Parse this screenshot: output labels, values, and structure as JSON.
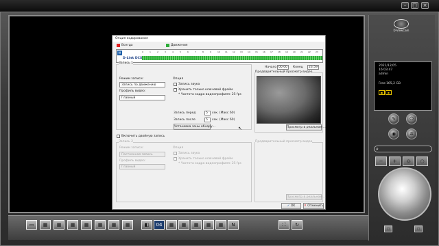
{
  "app": {
    "title": ""
  },
  "dialog": {
    "title": "Опция кодирования",
    "legend_always": "Всегда",
    "legend_motion": "Движения",
    "camera_name": "D-Link DCS",
    "ticks": [
      "0",
      "1",
      "2",
      "3",
      "4",
      "5",
      "6",
      "7",
      "8",
      "9",
      "10",
      "11",
      "12",
      "13",
      "14",
      "15",
      "16",
      "17",
      "18",
      "19",
      "20",
      "21",
      "22",
      "23"
    ],
    "start_label": "Начало",
    "start_value": "00:00",
    "end_label": "Конец",
    "end_value": "23:59",
    "rec1": {
      "group_title": "Запись 1",
      "mode_label": "Режим записи:",
      "mode_value": "Запись по движению",
      "profile_label": "Профиль видео:",
      "profile_value": "Главный",
      "option_title": "Опция",
      "audio_label": "Запись звука",
      "keyframe_label": "Хранить только ключевой фрейм",
      "fps_note": "* Частота кадра видеопрофиля: 25 fps",
      "pre_label": "Запись перед",
      "pre_value": "5",
      "pre_unit": "сек. (Макс 60)",
      "post_label": "Запись после",
      "post_value": "5",
      "post_unit": "сек. (Макс 60)",
      "zone_button": "Установка зоны обнару..."
    },
    "preview_title": "Предварительный просмотр видео",
    "preview_button": "Просмотр в реальном ...",
    "dual_label": "Включить двойную запись",
    "rec2": {
      "group_title": "Запись 2",
      "mode_label": "Режим записи:",
      "mode_value": "Постоянная запись",
      "profile_label": "Профиль видео:",
      "profile_value": "Главный",
      "option_title": "Опция",
      "audio_label": "Запись звука",
      "keyframe_label": "Хранить только ключевой фрейм",
      "fps_note": "* Частота кадра видеопрофиля: 25 fps"
    },
    "preview2_title": "Предварительный просмотр видео",
    "preview2_button": "Просмотр в реальном ...",
    "ok_label": "OK",
    "cancel_label": "Отменить",
    "always_color": "#e02020",
    "motion_color": "#2fae3a"
  },
  "right_panel": {
    "logo_text": "D-ViewCam",
    "date": "2021/12/05",
    "time": "16:03:47",
    "user": "admin",
    "free_space": "Free:165,2 GB"
  },
  "bottom_bar": {
    "page_number": "04"
  }
}
